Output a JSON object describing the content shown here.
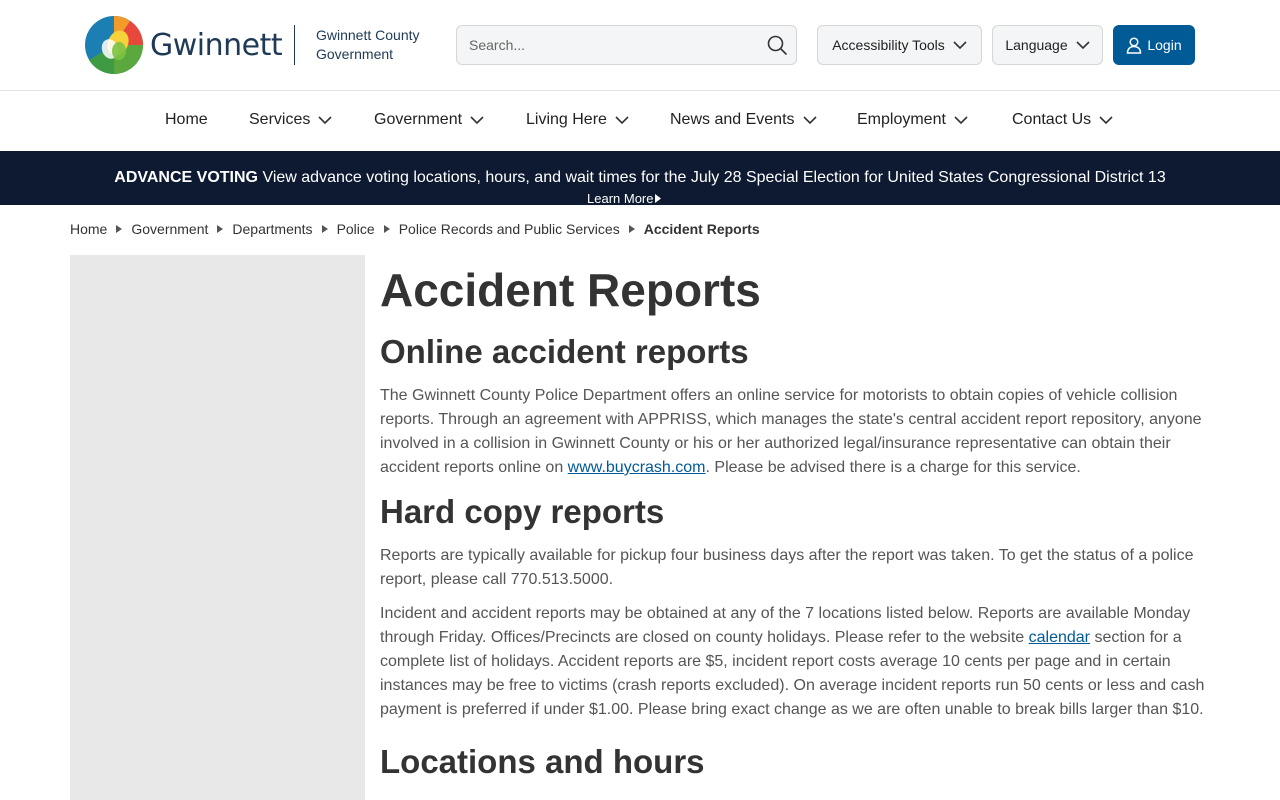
{
  "header": {
    "logo_word": "Gwinnett",
    "logo_sub_line1": "Gwinnett County",
    "logo_sub_line2": "Government",
    "search_placeholder": "Search...",
    "accessibility_label": "Accessibility Tools",
    "language_label": "Language",
    "login_label": "Login",
    "login_color": "#005a96"
  },
  "nav": {
    "items": [
      {
        "label": "Home"
      },
      {
        "label": "Services"
      },
      {
        "label": "Government"
      },
      {
        "label": "Living Here"
      },
      {
        "label": "News and Events"
      },
      {
        "label": "Employment"
      },
      {
        "label": "Contact Us"
      }
    ]
  },
  "alert": {
    "bold": "ADVANCE VOTING",
    "text": "View advance voting locations, hours, and wait times for the July 28 Special Election for United States Congressional District 13",
    "link": "Learn More",
    "bg_color": "#0d1a31"
  },
  "breadcrumb": {
    "items": [
      "Home",
      "Government",
      "Departments",
      "Police",
      "Police Records and Public Services"
    ],
    "current": "Accident Reports"
  },
  "content": {
    "title": "Accident Reports",
    "online_heading": "Online accident reports",
    "online_text_before": "The Gwinnett County Police Department offers an online service for motorists to obtain copies of vehicle collision reports. Through an agreement with  APPRISS, which manages the state's central accident report repository, anyone involved in a collision in Gwinnett County or his or her authorized legal/insurance representative can obtain their accident reports online on ",
    "online_link": "www.buycrash.com",
    "online_text_after": ". Please be advised there is a charge for this service.",
    "hard_heading": "Hard copy reports",
    "hard_p1": "Reports are typically available for pickup four business days after the report was taken. To get the status of a police report, please call 770.513.5000.",
    "hard_p2_before": "Incident and accident reports may be obtained at any of the 7 locations listed below.   Reports are available Monday through Friday. Offices/Precincts are closed on county holidays.  Please refer to the website ",
    "hard_p2_link": "calendar",
    "hard_p2_after": " section for a complete list of holidays.  Accident reports are $5, incident report costs average 10 cents per page and in certain instances may be free to victims (crash reports excluded).  On average incident reports run 50 cents or less and cash payment is preferred if under $1.00.   Please bring exact change as we are often unable to break bills larger than $10.",
    "locations_heading": "Locations and hours"
  }
}
